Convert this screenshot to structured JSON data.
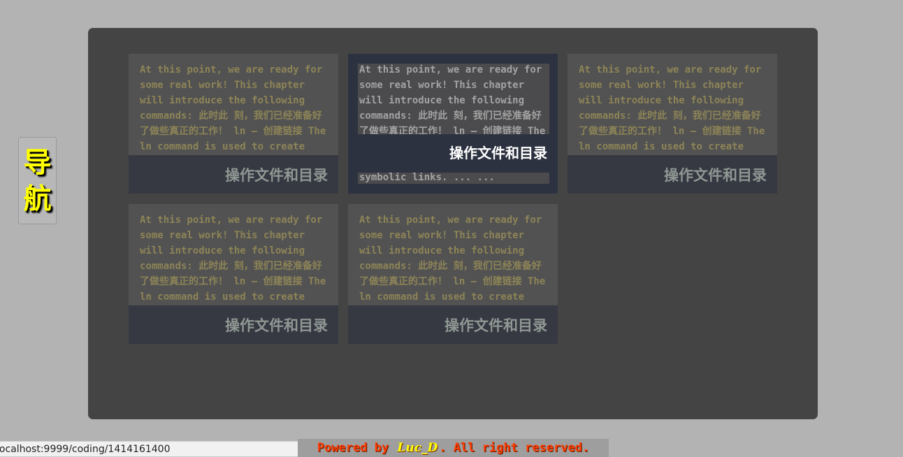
{
  "nav": {
    "line1": "导",
    "line2": "航"
  },
  "cards": [
    {
      "excerpt": "At this point, we are ready for some real work! This chapter will introduce the following commands: 此时此 刻，我们已经准备好了做些真正的工作！ ln — 创建链接 The ln command is used to create either hard or symbolic links. ... ...",
      "title": "操作文件和目录"
    },
    {
      "excerpt": "At this point, we are ready for some real work! This chapter will introduce the following commands: 此时此 刻，我们已经准备好了做些真正的工作！ ln — 创建链接 The ln command is used to create either hard or symbolic links. ... ...",
      "title": "操作文件和目录",
      "tail": "symbolic links. ... ..."
    },
    {
      "excerpt": "At this point, we are ready for some real work! This chapter will introduce the following commands: 此时此 刻，我们已经准备好了做些真正的工作！ ln — 创建链接 The ln command is used to create either hard or symbolic links. ... ...",
      "title": "操作文件和目录"
    },
    {
      "excerpt": "At this point, we are ready for some real work! This chapter will introduce the following commands: 此时此 刻，我们已经准备好了做些真正的工作！ ln — 创建链接 The ln command is used to create either hard or symbolic links. ... ...",
      "title": "操作文件和目录"
    },
    {
      "excerpt": "At this point, we are ready for some real work! This chapter will introduce the following commands: 此时此 刻，我们已经准备好了做些真正的工作！ ln — 创建链接 The ln command is used to create either hard or symbolic links. ... ...",
      "title": "操作文件和目录"
    }
  ],
  "status_url": "localhost:9999/coding/1414161400",
  "footer": {
    "prefix": "Powered by ",
    "author": "Luc_D",
    "suffix": ". All right reserved."
  },
  "colors": {
    "page_bg": "#b3b3b3",
    "panel_bg": "#444444",
    "card_bg": "#525252",
    "card_title_bar": "#363842",
    "hover_card_bg": "#2d3240",
    "nav_text": "#ffff00",
    "footer_text": "#ff3c00"
  }
}
